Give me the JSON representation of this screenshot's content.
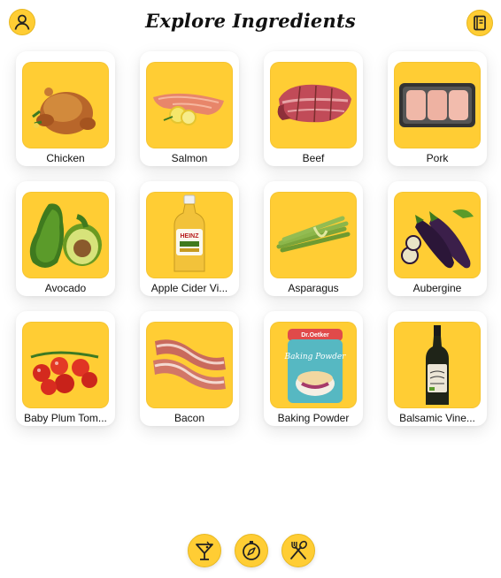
{
  "header": {
    "title": "Explore Ingredients",
    "profile_icon": "user-icon",
    "book_icon": "recipe-book-icon"
  },
  "ingredients": [
    {
      "label": "Chicken",
      "image": "roast-chicken"
    },
    {
      "label": "Salmon",
      "image": "salmon-fillet"
    },
    {
      "label": "Beef",
      "image": "beef-joint"
    },
    {
      "label": "Pork",
      "image": "pork-chops-tray"
    },
    {
      "label": "Avocado",
      "image": "avocado"
    },
    {
      "label": "Apple Cider Vi...",
      "image": "vinegar-bottle"
    },
    {
      "label": "Asparagus",
      "image": "asparagus"
    },
    {
      "label": "Aubergine",
      "image": "aubergine"
    },
    {
      "label": "Baby Plum Tom...",
      "image": "cherry-tomatoes"
    },
    {
      "label": "Bacon",
      "image": "bacon"
    },
    {
      "label": "Baking Powder",
      "image": "baking-powder-tub"
    },
    {
      "label": "Balsamic Vine...",
      "image": "balsamic-bottle"
    }
  ],
  "bottom_nav": {
    "items": [
      {
        "icon": "cocktail-icon"
      },
      {
        "icon": "compass-icon"
      },
      {
        "icon": "fork-spoon-icon"
      }
    ]
  },
  "colors": {
    "accent": "#ffcd34",
    "card": "#ffffff",
    "text": "#111111"
  },
  "package_text": {
    "brand": "Dr.Oetker",
    "baking_powder": "Baking Powder",
    "heinz": "HEINZ"
  }
}
